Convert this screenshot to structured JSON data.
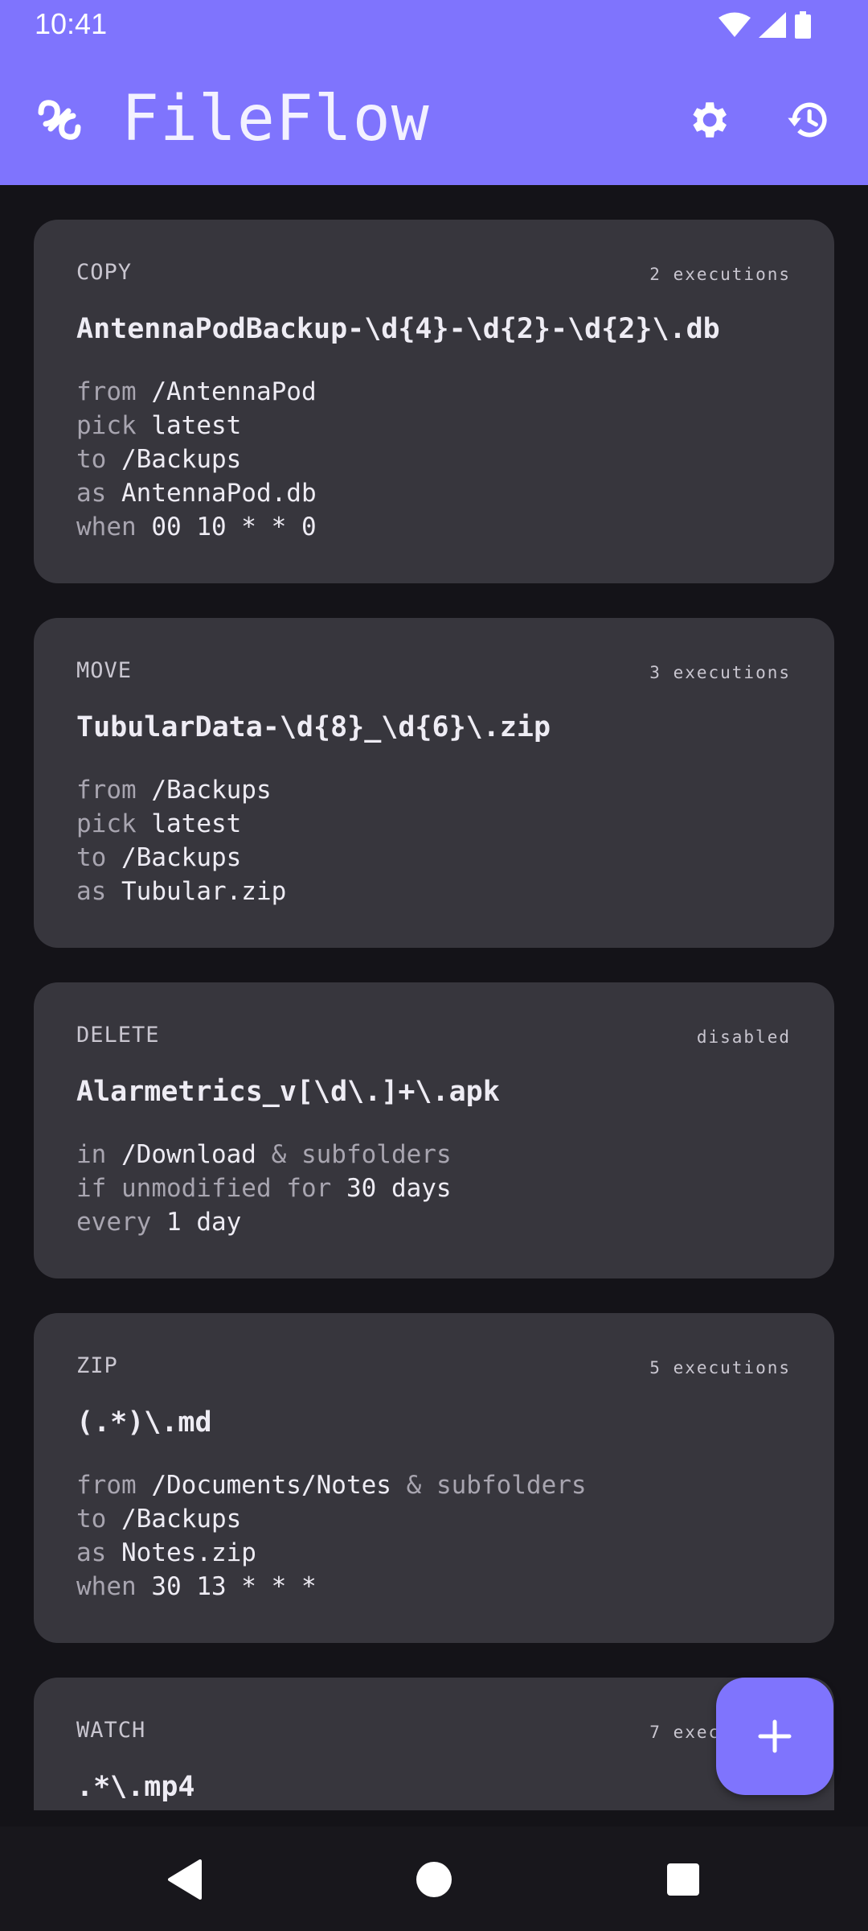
{
  "status_bar": {
    "time": "10:41",
    "icons": [
      "wifi-icon",
      "signal-icon",
      "battery-icon"
    ]
  },
  "app_bar": {
    "title": "FileFlow",
    "logo_icon": "link-icon",
    "actions": [
      {
        "name": "settings",
        "icon": "gear-icon"
      },
      {
        "name": "history",
        "icon": "history-icon"
      }
    ]
  },
  "colors": {
    "accent": "#7f74fd",
    "background": "#141318",
    "card": "#37363d"
  },
  "rules": [
    {
      "type": "COPY",
      "status": "2 executions",
      "pattern": "AntennaPodBackup-\\d{4}-\\d{2}-\\d{2}\\.db",
      "lines": [
        {
          "kw": "from",
          "val": "/AntennaPod",
          "rest_kw": "",
          "rest_val": ""
        },
        {
          "kw": "pick",
          "val": "latest",
          "rest_kw": "",
          "rest_val": ""
        },
        {
          "kw": "to",
          "val": "/Backups",
          "rest_kw": "",
          "rest_val": ""
        },
        {
          "kw": "as",
          "val": "AntennaPod.db",
          "rest_kw": "",
          "rest_val": ""
        },
        {
          "kw": "when",
          "val": "00 10 * * 0",
          "rest_kw": "",
          "rest_val": ""
        }
      ]
    },
    {
      "type": "MOVE",
      "status": "3 executions",
      "pattern": "TubularData-\\d{8}_\\d{6}\\.zip",
      "lines": [
        {
          "kw": "from",
          "val": "/Backups",
          "rest_kw": "",
          "rest_val": ""
        },
        {
          "kw": "pick",
          "val": "latest",
          "rest_kw": "",
          "rest_val": ""
        },
        {
          "kw": "to",
          "val": "/Backups",
          "rest_kw": "",
          "rest_val": ""
        },
        {
          "kw": "as",
          "val": "Tubular.zip",
          "rest_kw": "",
          "rest_val": ""
        }
      ]
    },
    {
      "type": "DELETE",
      "status": "disabled",
      "pattern": "Alarmetrics_v[\\d\\.]+\\.apk",
      "lines": [
        {
          "kw": "in",
          "val": "/Download",
          "rest_kw": "& subfolders",
          "rest_val": ""
        },
        {
          "kw": "if unmodified for",
          "val": "30 days",
          "rest_kw": "",
          "rest_val": ""
        },
        {
          "kw": "every",
          "val": "1 day",
          "rest_kw": "",
          "rest_val": ""
        }
      ]
    },
    {
      "type": "ZIP",
      "status": "5 executions",
      "pattern": "(.*)\\.md",
      "lines": [
        {
          "kw": "from",
          "val": "/Documents/Notes",
          "rest_kw": "& subfolders",
          "rest_val": ""
        },
        {
          "kw": "to",
          "val": "/Backups",
          "rest_kw": "",
          "rest_val": ""
        },
        {
          "kw": "as",
          "val": "Notes.zip",
          "rest_kw": "",
          "rest_val": ""
        },
        {
          "kw": "when",
          "val": "30 13 * * *",
          "rest_kw": "",
          "rest_val": ""
        }
      ]
    },
    {
      "type": "WATCH",
      "status": "7 executions",
      "pattern": ".*\\.mp4",
      "lines": []
    }
  ],
  "fab": {
    "icon": "plus-icon"
  },
  "nav_bar": {
    "buttons": [
      {
        "name": "back",
        "icon": "back-triangle-icon"
      },
      {
        "name": "home",
        "icon": "home-circle-icon"
      },
      {
        "name": "recents",
        "icon": "recents-square-icon"
      }
    ]
  }
}
